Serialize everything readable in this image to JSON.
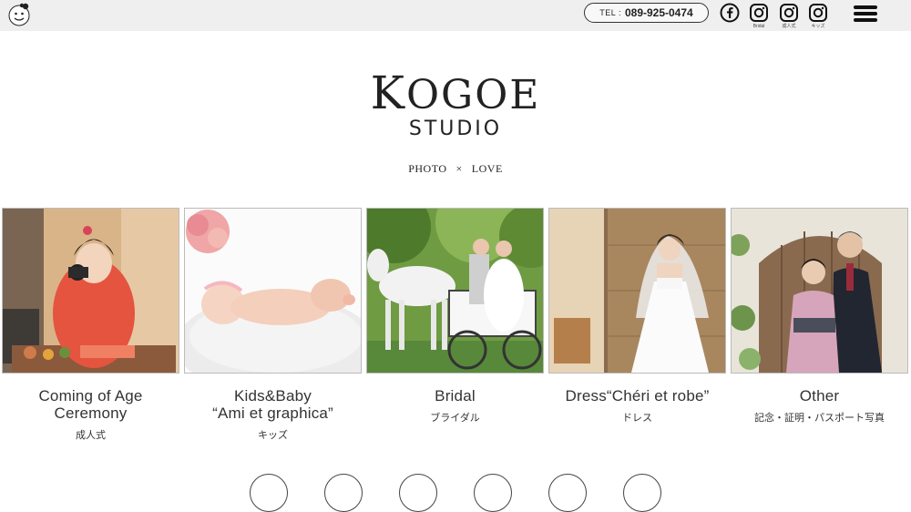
{
  "header": {
    "logo_icon": "studio-face-logo-icon",
    "tel_label": "TEL :",
    "tel_number": "089-925-0474",
    "social": [
      {
        "icon": "facebook-icon",
        "caption": ""
      },
      {
        "icon": "instagram-icon",
        "caption": "Bridal"
      },
      {
        "icon": "instagram-icon",
        "caption": "成人式"
      },
      {
        "icon": "instagram-icon",
        "caption": "キッズ"
      }
    ],
    "menu_icon": "hamburger-menu-icon"
  },
  "brand": {
    "main_first": "K",
    "main_rest": "OGOE",
    "sub": "STUDIO"
  },
  "tagline": {
    "left": "PHOTO",
    "sep": "×",
    "right": "LOVE"
  },
  "cards": [
    {
      "title_line1": "Coming of Age",
      "title_line2": "Ceremony",
      "subtitle": "成人式"
    },
    {
      "title_line1": "Kids&Baby",
      "title_line2": "“Ami et graphica”",
      "subtitle": "キッズ"
    },
    {
      "title_line1": "Bridal",
      "title_line2": "",
      "subtitle": "ブライダル"
    },
    {
      "title_line1": "Dress“Chéri et robe”",
      "title_line2": "",
      "subtitle": "ドレス"
    },
    {
      "title_line1": "Other",
      "title_line2": "",
      "subtitle": "記念・証明・パスポート写真"
    }
  ],
  "colors": {
    "topbar_bg": "#efefef",
    "text": "#222222"
  }
}
